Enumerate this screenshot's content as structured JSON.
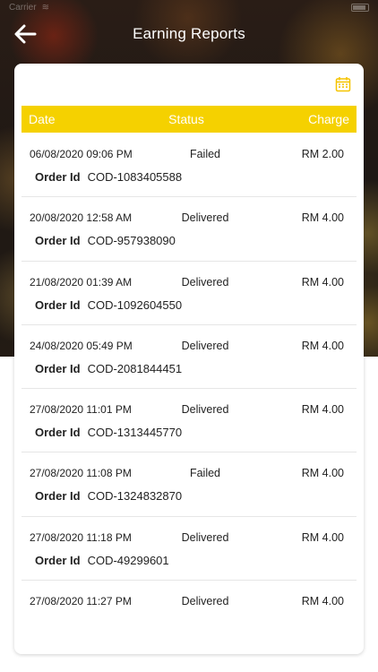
{
  "status_bar": {
    "carrier": "Carrier",
    "time": ""
  },
  "header": {
    "title": "Earning Reports",
    "back_icon": "arrow-left-icon"
  },
  "toolbar": {
    "calendar_icon": "calendar-icon"
  },
  "table": {
    "columns": {
      "date": "Date",
      "status": "Status",
      "charge": "Charge"
    },
    "order_label": "Order Id",
    "rows": [
      {
        "date": "06/08/2020 09:06 PM",
        "status": "Failed",
        "charge": "RM 2.00",
        "order_id": "COD-1083405588"
      },
      {
        "date": "20/08/2020 12:58 AM",
        "status": "Delivered",
        "charge": "RM 4.00",
        "order_id": "COD-957938090"
      },
      {
        "date": "21/08/2020 01:39 AM",
        "status": "Delivered",
        "charge": "RM 4.00",
        "order_id": "COD-1092604550"
      },
      {
        "date": "24/08/2020 05:49 PM",
        "status": "Delivered",
        "charge": "RM 4.00",
        "order_id": "COD-2081844451"
      },
      {
        "date": "27/08/2020 11:01 PM",
        "status": "Delivered",
        "charge": "RM 4.00",
        "order_id": "COD-1313445770"
      },
      {
        "date": "27/08/2020 11:08 PM",
        "status": "Failed",
        "charge": "RM 4.00",
        "order_id": "COD-1324832870"
      },
      {
        "date": "27/08/2020 11:18 PM",
        "status": "Delivered",
        "charge": "RM 4.00",
        "order_id": "COD-49299601"
      },
      {
        "date": "27/08/2020 11:27 PM",
        "status": "Delivered",
        "charge": "RM 4.00",
        "order_id": ""
      }
    ]
  },
  "colors": {
    "accent": "#f5d100",
    "header_text": "#ffffff"
  }
}
